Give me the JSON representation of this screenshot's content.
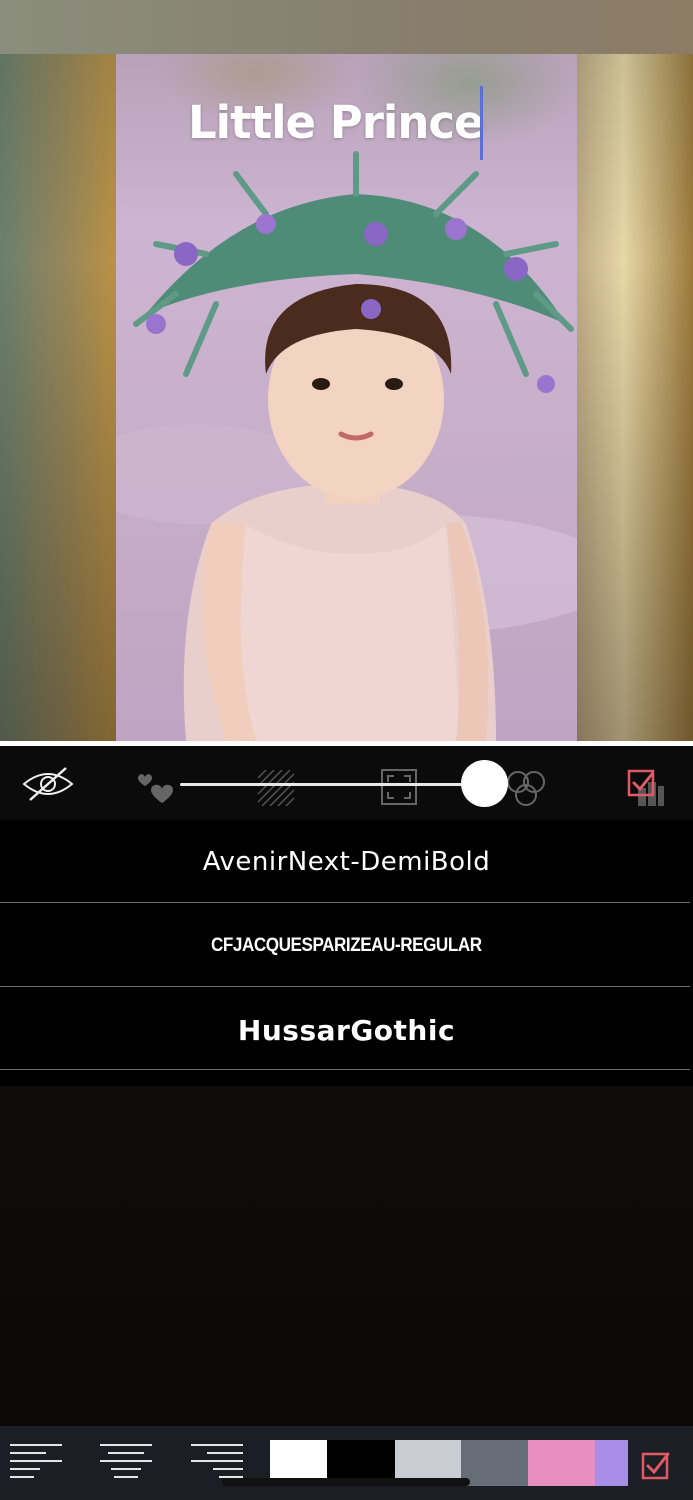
{
  "overlay_text": {
    "content": "Little Prince"
  },
  "toolbar": {
    "icons": [
      "eye-off-icon",
      "hearts-icon",
      "pattern-texture-icon",
      "frame-icon",
      "circles-blend-icon",
      "check-layers-icon"
    ],
    "opacity_level": 0.93
  },
  "font_list": {
    "items": [
      {
        "name": "AvenirNext-DemiBold"
      },
      {
        "name": "CFJacquesParizeau-Regular"
      },
      {
        "name": "HussarGothic"
      }
    ]
  },
  "bottom_bar": {
    "alignments": [
      "align-left-icon",
      "align-center-icon",
      "align-right-icon"
    ],
    "colors": [
      "#ffffff",
      "#000000",
      "#c9ccd2",
      "#676d76",
      "#e78fc0",
      "#a98ee8"
    ],
    "confirm_icon": "check-box-icon"
  },
  "theme": {
    "accent": "#e05a66",
    "caret": "#5b6fd6"
  }
}
